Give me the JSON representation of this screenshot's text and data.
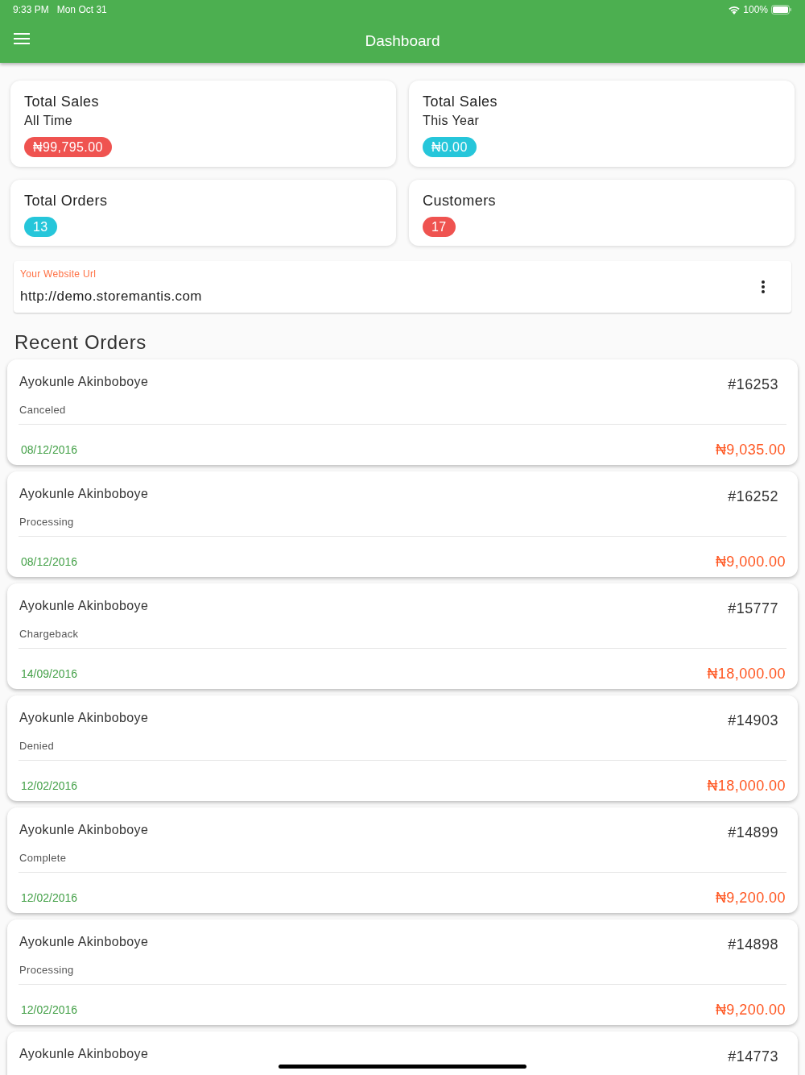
{
  "status_bar": {
    "time": "9:33 PM",
    "date": "Mon Oct 31",
    "battery": "100%"
  },
  "app_bar": {
    "title": "Dashboard"
  },
  "stats": [
    {
      "title": "Total Sales",
      "subtitle": "All Time",
      "value": "₦99,795.00",
      "color": "#ef5350"
    },
    {
      "title": "Total Sales",
      "subtitle": "This Year",
      "value": "₦0.00",
      "color": "#26c6da"
    },
    {
      "title": "Total Orders",
      "value": "13",
      "color": "#26c6da"
    },
    {
      "title": "Customers",
      "value": "17",
      "color": "#ef5350"
    }
  ],
  "website_field": {
    "label": "Your Website Url",
    "value": "http://demo.storemantis.com"
  },
  "recent_orders": {
    "heading": "Recent Orders",
    "orders": [
      {
        "customer": "Ayokunle Akinboboye",
        "number": "#16253",
        "status": "Canceled",
        "date": "08/12/2016",
        "amount": "₦9,035.00"
      },
      {
        "customer": "Ayokunle Akinboboye",
        "number": "#16252",
        "status": "Processing",
        "date": "08/12/2016",
        "amount": "₦9,000.00"
      },
      {
        "customer": "Ayokunle Akinboboye",
        "number": "#15777",
        "status": "Chargeback",
        "date": "14/09/2016",
        "amount": "₦18,000.00"
      },
      {
        "customer": "Ayokunle Akinboboye",
        "number": "#14903",
        "status": "Denied",
        "date": "12/02/2016",
        "amount": "₦18,000.00"
      },
      {
        "customer": "Ayokunle Akinboboye",
        "number": "#14899",
        "status": "Complete",
        "date": "12/02/2016",
        "amount": "₦9,200.00"
      },
      {
        "customer": "Ayokunle Akinboboye",
        "number": "#14898",
        "status": "Processing",
        "date": "12/02/2016",
        "amount": "₦9,200.00"
      },
      {
        "customer": "Ayokunle Akinboboye",
        "number": "#14773"
      }
    ]
  }
}
